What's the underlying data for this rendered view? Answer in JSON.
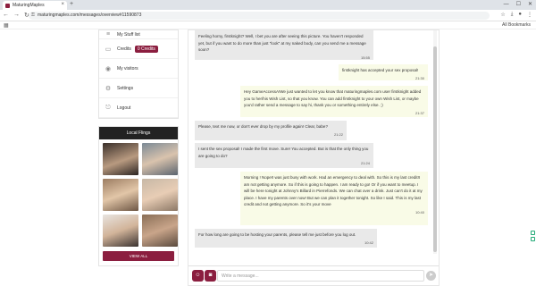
{
  "browser": {
    "tab_title": "MaturingMaples",
    "url": "maturingmaples.com/messages/overview#11590873",
    "all_bookmarks": "All Bookmarks"
  },
  "sidebar": {
    "items": [
      {
        "label": "My Stuff list",
        "icon": "list-icon"
      },
      {
        "label": "Credits",
        "badge": "0 Credits",
        "icon": "credits-icon"
      },
      {
        "label": "My visitors",
        "icon": "eye-icon"
      },
      {
        "label": "Settings",
        "icon": "gear-icon"
      },
      {
        "label": "Logout",
        "icon": "logout-icon"
      }
    ],
    "flings_title": "Local Flings",
    "view_all": "VIEW ALL"
  },
  "colors": {
    "brand": "#8b1e3f",
    "incoming": "#e9e9e9",
    "outgoing": "#f9fbe7"
  },
  "messages": [
    {
      "dir": "in",
      "text": "Feeling horny, firstknight? Well, I bet you are after seeing this picture. You haven't responded yet, but if you want to do more than just \"look\" at my naked body, can you send me a message soon?",
      "time": "15:55"
    },
    {
      "dir": "out",
      "text": "firstknight has accepted your sex proposal!",
      "time": "21:30"
    },
    {
      "dir": "out",
      "text": "Hey GameAccessA!We just wanted to let you know that maturingmaples.com user firstknight added you to her/his Wish List, so that you know. You can add firstknight to your own Wish List, or maybe you'd rather send a message to say hi, thank you or something entirely else. ;)",
      "time": "21:37"
    },
    {
      "dir": "in",
      "text": "Please, text me now, or don't ever drop by my profile again! Clear, babe?",
      "time": "21:22"
    },
    {
      "dir": "in",
      "text": "I sent the sex proposal! I made the first move. Sure! You accepted. But is that the only thing you are going to do?",
      "time": "21:24"
    },
    {
      "dir": "out",
      "text": "Morning ! Nope!I was just busy with work. Had an emergency to deal with. So this is my last credit!I am not getting anymore. So if this is going to happen. I am ready to go! Or if you want to meetup. I will be here tonight at Johnny's Billard in Pierrefonds. We can chat over a drink. Just can't do it at my place. I have my parents over now! But we can plan it together tonight. So like I said. This is my last credit and not getting anymore. So it's your move",
      "time": "10:40"
    },
    {
      "dir": "in",
      "text": "For how long are going to be hosting your parents, please tell me just before you log out.",
      "time": "10:42"
    }
  ],
  "compose": {
    "placeholder": "Write a message..."
  }
}
